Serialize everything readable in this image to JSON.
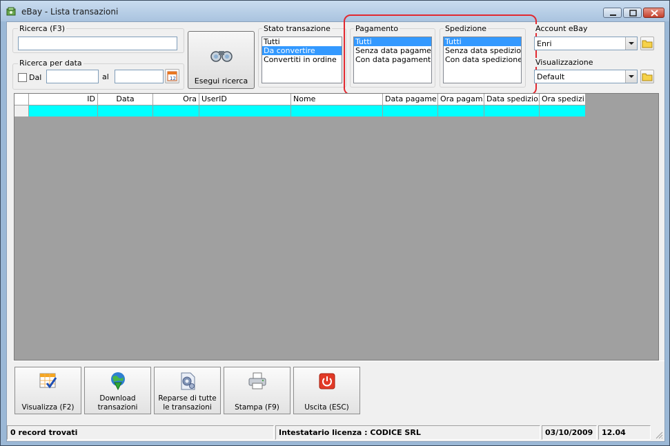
{
  "window": {
    "title": "eBay - Lista transazioni",
    "controls": [
      "minimize-icon",
      "maximize-icon",
      "close-icon"
    ]
  },
  "search": {
    "group_label": "Ricerca (F3)",
    "value": ""
  },
  "date_search": {
    "group_label": "Ricerca per data",
    "from_label": "Dal",
    "from_value": "",
    "to_label": "al",
    "to_value": "",
    "from_checked": false
  },
  "search_button": {
    "label": "Esegui ricerca",
    "icon": "binoculars-icon"
  },
  "transaction_state": {
    "label": "Stato transazione",
    "items": [
      "Tutti",
      "Da convertire",
      "Convertiti in ordine"
    ],
    "selected_index": 1
  },
  "payment": {
    "label": "Pagamento",
    "items": [
      "Tutti",
      "Senza data pagamento",
      "Con data pagamento"
    ],
    "selected_index": 0
  },
  "shipping": {
    "label": "Spedizione",
    "items": [
      "Tutti",
      "Senza data spedizione",
      "Con data spedizione"
    ],
    "selected_index": 0
  },
  "account": {
    "label": "Account eBay",
    "value": "Enri"
  },
  "view": {
    "label": "Visualizzazione",
    "value": "Default"
  },
  "grid": {
    "columns": [
      "ID",
      "Data",
      "Ora",
      "UserID",
      "Nome",
      "Data pagame...",
      "Ora pagam...",
      "Data spedizio...",
      "Ora spedizi..."
    ],
    "rows": 1,
    "row_color": "#00ffff"
  },
  "toolbar": {
    "buttons": [
      {
        "label": "Visualizza (F2)",
        "icon": "grid-check-icon"
      },
      {
        "label": "Download transazioni",
        "icon": "download-globe-icon"
      },
      {
        "label": "Reparse di tutte le transazioni",
        "icon": "gear-document-icon"
      },
      {
        "label": "Stampa (F9)",
        "icon": "printer-icon"
      },
      {
        "label": "Uscita (ESC)",
        "icon": "power-icon"
      }
    ]
  },
  "status": {
    "records": "0 record trovati",
    "license": "Intestatario licenza : CODICE SRL",
    "date": "03/10/2009",
    "time": "12.04"
  },
  "colors": {
    "highlight": "#e2282f",
    "selection": "#3399ff",
    "grid_row": "#00ffff"
  }
}
